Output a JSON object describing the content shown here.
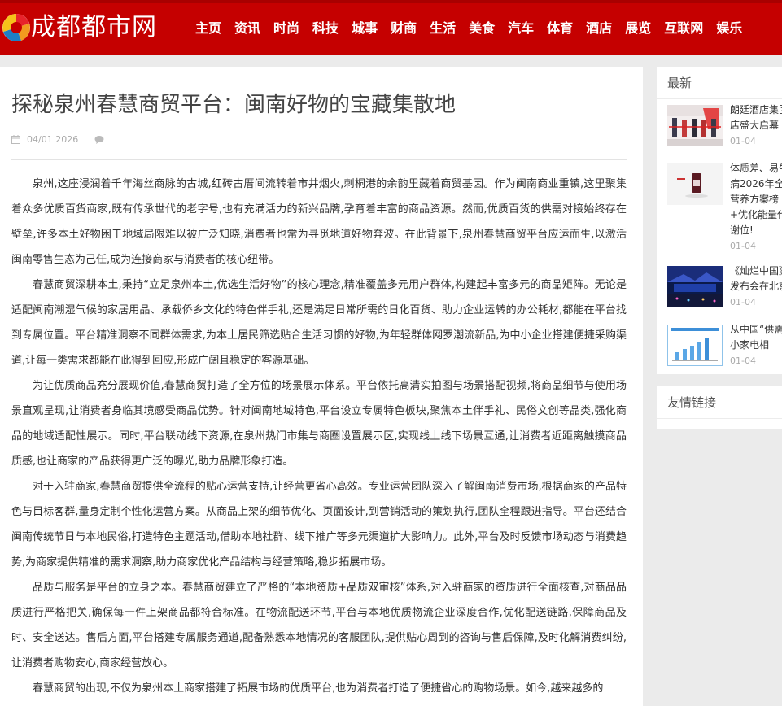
{
  "site": {
    "name": "成都都市网",
    "nav": [
      "主页",
      "资讯",
      "时尚",
      "科技",
      "城事",
      "财商",
      "生活",
      "美食",
      "汽车",
      "体育",
      "酒店",
      "展览",
      "互联网",
      "娱乐"
    ]
  },
  "article": {
    "title": "探秘泉州春慧商贸平台：闽南好物的宝藏集散地",
    "date": "04/01 2026",
    "paragraphs": [
      "泉州,这座浸润着千年海丝商脉的古城,红砖古厝间流转着市井烟火,刺桐港的余韵里藏着商贸基因。作为闽南商业重镇,这里聚集着众多优质百货商家,既有传承世代的老字号,也有充满活力的新兴品牌,孕育着丰富的商品资源。然而,优质百货的供需对接始终存在壁垒,许多本土好物困于地域局限难以被广泛知晓,消费者也常为寻觅地道好物奔波。在此背景下,泉州春慧商贸平台应运而生,以激活闽南零售生态为己任,成为连接商家与消费者的核心纽带。",
      "春慧商贸深耕本土,秉持“立足泉州本土,优选生活好物”的核心理念,精准覆盖多元用户群体,构建起丰富多元的商品矩阵。无论是适配闽南潮湿气候的家居用品、承载侨乡文化的特色伴手礼,还是满足日常所需的日化百货、助力企业运转的办公耗材,都能在平台找到专属位置。平台精准洞察不同群体需求,为本土居民筛选贴合生活习惯的好物,为年轻群体网罗潮流新品,为中小企业搭建便捷采购渠道,让每一类需求都能在此得到回应,形成广阔且稳定的客源基础。",
      "为让优质商品充分展现价值,春慧商贸打造了全方位的场景展示体系。平台依托高清实拍图与场景搭配视频,将商品细节与使用场景直观呈现,让消费者身临其境感受商品优势。针对闽南地域特色,平台设立专属特色板块,聚焦本土伴手礼、民俗文创等品类,强化商品的地域适配性展示。同时,平台联动线下资源,在泉州热门市集与商圈设置展示区,实现线上线下场景互通,让消费者近距离触摸商品质感,也让商家的产品获得更广泛的曝光,助力品牌形象打造。",
      "对于入驻商家,春慧商贸提供全流程的贴心运营支持,让经营更省心高效。专业运营团队深入了解闽南消费市场,根据商家的产品特色与目标客群,量身定制个性化运营方案。从商品上架的细节优化、页面设计,到营销活动的策划执行,团队全程跟进指导。平台还结合闽南传统节日与本地民俗,打造特色主题活动,借助本地社群、线下推广等多元渠道扩大影响力。此外,平台及时反馈市场动态与消费趋势,为商家提供精准的需求洞察,助力商家优化产品结构与经营策略,稳步拓展市场。",
      "品质与服务是平台的立身之本。春慧商贸建立了严格的“本地资质+品质双审核”体系,对入驻商家的资质进行全面核查,对商品品质进行严格把关,确保每一件上架商品都符合标准。在物流配送环节,平台与本地优质物流企业深度合作,优化配送链路,保障商品及时、安全送达。售后方面,平台搭建专属服务通道,配备熟悉本地情况的客服团队,提供贴心周到的咨询与售后保障,及时化解消费纠纷,让消费者购物安心,商家经营放心。",
      "春慧商贸的出现,不仅为泉州本土商家搭建了拓展市场的优质平台,也为消费者打造了便捷省心的购物场景。如今,越来越多的"
    ]
  },
  "sidebar": {
    "latest_title": "最新",
    "links_title": "友情链接",
    "news": [
      {
        "title": "朗廷酒店集团店盛大启幕",
        "date": "01-04"
      },
      {
        "title": "体质差、易生病2026年全球营养方案榜+优化能量代谢位!",
        "date": "01-04"
      },
      {
        "title": "《灿烂中国》发布会在北京",
        "date": "01-04"
      },
      {
        "title": "从中国“供需存小家电相",
        "date": "01-04"
      }
    ]
  },
  "colors": {
    "brand_red": "#c50000",
    "page_bg": "#ebebeb",
    "muted": "#aaaaaa"
  }
}
